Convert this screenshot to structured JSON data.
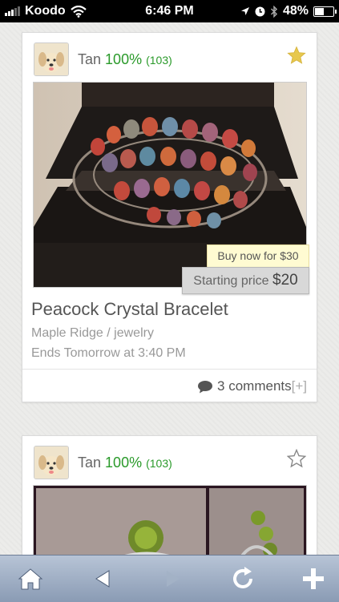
{
  "status_bar": {
    "carrier": "Koodo",
    "time": "6:46 PM",
    "battery": "48%",
    "battery_level": 0.48,
    "icons": [
      "signal-icon",
      "wifi-icon",
      "location-icon",
      "clock-icon",
      "bluetooth-icon",
      "battery-icon"
    ]
  },
  "listings": [
    {
      "seller": {
        "name": "Tan",
        "rating": "100%",
        "count": "(103)"
      },
      "favorited": true,
      "buy_now": "Buy now for $30",
      "starting_label": "Starting price",
      "starting_price": "$20",
      "title": "Peacock Crystal Bracelet",
      "location": "Maple Ridge / jewelry",
      "ends": "Ends Tomorrow at 3:40 PM",
      "comments": "3 comments",
      "expand": "[+]"
    },
    {
      "seller": {
        "name": "Tan",
        "rating": "100%",
        "count": "(103)"
      },
      "favorited": false
    }
  ],
  "colors": {
    "rating_green": "#2a9a2a",
    "star_gold": "#e7c84e",
    "toolbar_blue": "#8a9bb4"
  },
  "toolbar": {
    "icons": [
      "home-icon",
      "back-icon",
      "forward-icon",
      "reload-icon",
      "add-icon"
    ]
  }
}
